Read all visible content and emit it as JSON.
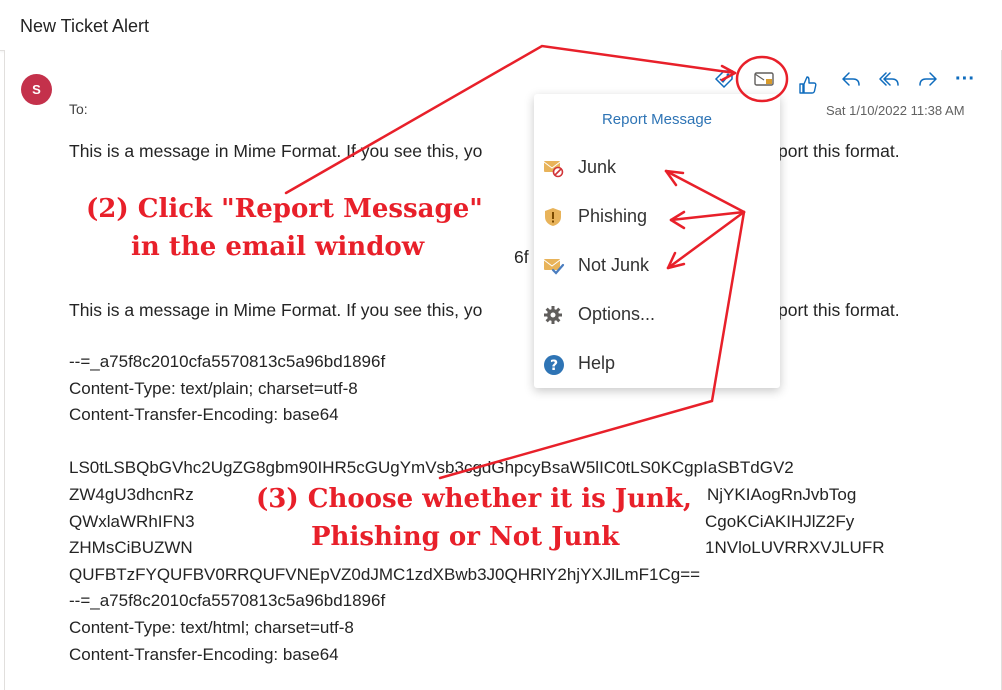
{
  "header": {
    "subject": "New Ticket Alert"
  },
  "message": {
    "avatar_initial": "S",
    "to_label": "To:",
    "timestamp": "Sat 1/10/2022 11:38 AM",
    "body_line_1a": "This is a message in Mime Format.  If you see this, yo",
    "body_line_1b": "port this format.",
    "partial_fragment": "6f",
    "body_line_2a": "This is a message in Mime Format.  If you see this, yo",
    "body_line_2b": "port this format.",
    "boundary_1": "--=_a75f8c2010cfa5570813c5a96bd1896f",
    "content_type_1": "Content-Type: text/plain; charset=utf-8",
    "encoding_1": "Content-Transfer-Encoding: base64",
    "b64_1": "LS0tLSBQbGVhc2UgZG8gbm90IHR5cGUgYmVsb3cgdGhpcyBsaW5lIC0tLS0KCgpIaSBTdGV2",
    "b64_2a": "ZW4gU3dhcnRz",
    "b64_2b": "NjYKIAogRnJvbTog",
    "b64_3a": "QWxlaWRhIFN3",
    "b64_3b": "CgoKCiAKIHJlZ2Fy",
    "b64_4a": "ZHMsCiBUZWN",
    "b64_4b": "1NVloLUVRRXVJLUFR",
    "b64_5": "QUFBTzFYQUFBV0RRQUFVNEpVZ0dJMC1zdXBwb3J0QHRlY2hjYXJlLmF1Cg==",
    "boundary_2": "--=_a75f8c2010cfa5570813c5a96bd1896f",
    "content_type_2": "Content-Type: text/html; charset=utf-8",
    "encoding_2": "Content-Transfer-Encoding: base64"
  },
  "toolbar": {
    "icons": [
      "tag-icon",
      "report-message-icon",
      "like-icon",
      "reply-icon",
      "reply-all-icon",
      "forward-icon",
      "more-icon"
    ],
    "more_label": "···"
  },
  "report_menu": {
    "title": "Report Message",
    "items": [
      {
        "label": "Junk",
        "icon": "junk-icon"
      },
      {
        "label": "Phishing",
        "icon": "phishing-icon"
      },
      {
        "label": "Not Junk",
        "icon": "not-junk-icon"
      },
      {
        "label": "Options...",
        "icon": "gear-icon"
      },
      {
        "label": "Help",
        "icon": "help-icon"
      }
    ]
  },
  "annotations": {
    "step2_line1": "(2) Click \"Report Message\"",
    "step2_line2": "in the email window",
    "step3_line1": "(3) Choose whether it is Junk,",
    "step3_line2": "Phishing or Not Junk",
    "color": "#e8202a"
  },
  "colors": {
    "accent": "#0f6cbd",
    "avatar": "#c4314b",
    "menu_title": "#2e74b5"
  }
}
